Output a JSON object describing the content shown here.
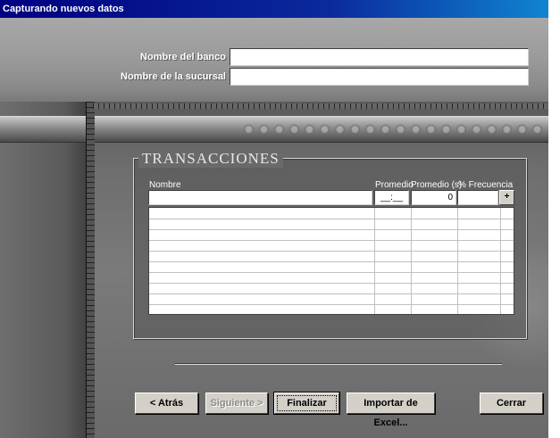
{
  "window": {
    "title": "Capturando nuevos datos"
  },
  "form": {
    "bank_label": "Nombre del banco",
    "bank_value": "",
    "branch_label": "Nombre de la sucursal",
    "branch_value": ""
  },
  "transactions": {
    "title": "TRANSACCIONES",
    "columns": [
      "Nombre",
      "Promedio",
      "Promedio (s)",
      "% Frecuencia"
    ],
    "new_row": {
      "name": "",
      "promedio": "__:__",
      "promedio_s": "0",
      "frecuencia": ""
    },
    "add_button": "+",
    "rows": []
  },
  "buttons": {
    "back": "< Atrás",
    "next": "Siguiente >",
    "finish": "Finalizar",
    "import": "Importar de Excel...",
    "close": "Cerrar"
  }
}
